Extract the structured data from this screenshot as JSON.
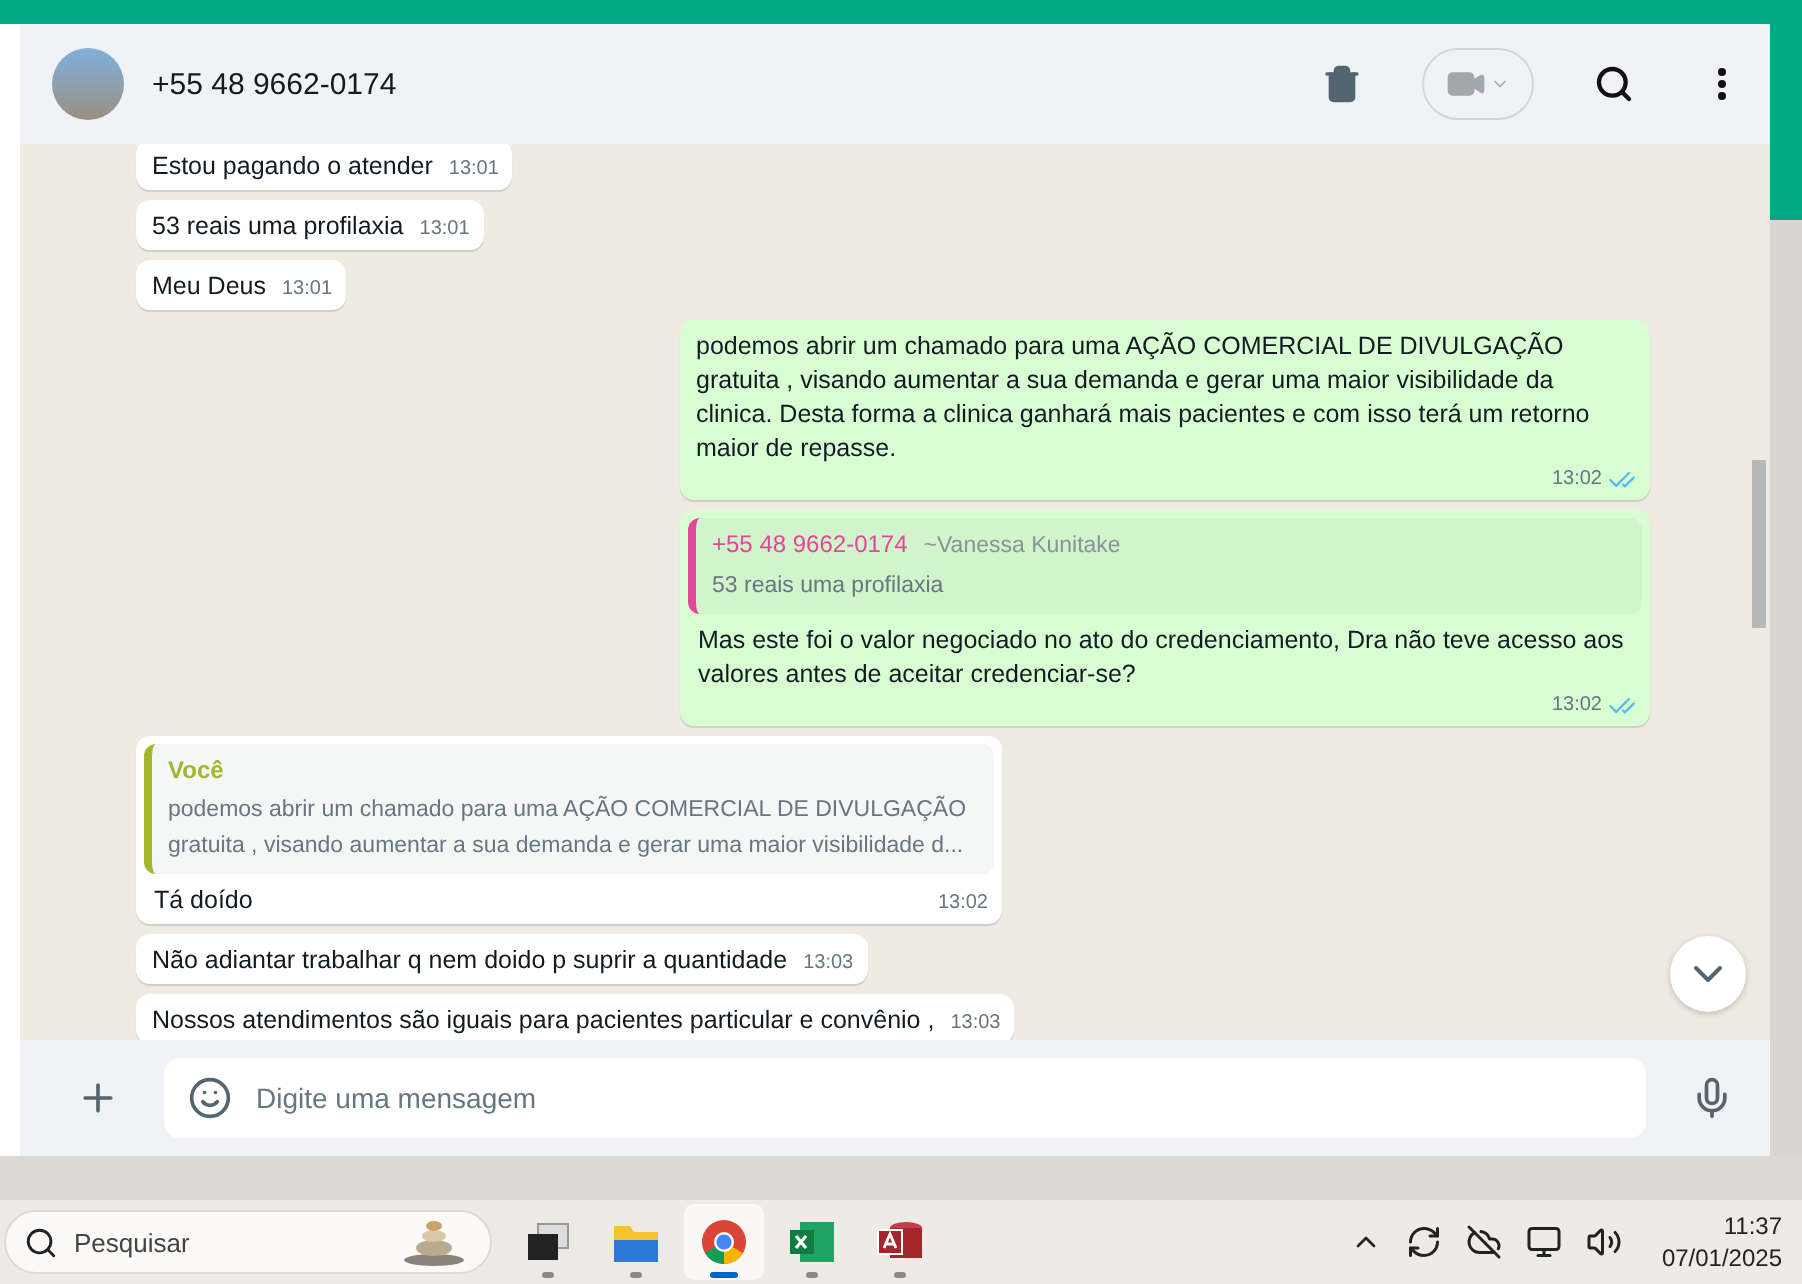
{
  "chat_header": {
    "contact": "+55 48 9662-0174"
  },
  "messages": [
    {
      "kind": "in",
      "text": "Estou pagando o atender",
      "time": "13:01"
    },
    {
      "kind": "in",
      "text": "53 reais uma profilaxia",
      "time": "13:01"
    },
    {
      "kind": "in",
      "text": "Meu Deus",
      "time": "13:01"
    },
    {
      "kind": "out",
      "text": "podemos abrir um chamado para uma AÇÃO COMERCIAL DE DIVULGAÇÃO gratuita , visando aumentar a sua demanda e gerar uma maior visibilidade da clinica. Desta forma a clinica ganhará mais pacientes e com isso terá um retorno maior de repasse.",
      "time": "13:02",
      "read": true
    },
    {
      "kind": "out",
      "quote": {
        "author": "+55 48 9662-0174",
        "author_note": "~Vanessa Kunitake",
        "text": "53 reais uma profilaxia",
        "color": "#e0489a"
      },
      "text": "Mas este foi o valor negociado no ato do credenciamento, Dra não teve acesso aos valores antes de aceitar credenciar-se?",
      "time": "13:02",
      "read": true
    },
    {
      "kind": "in",
      "quote": {
        "author": "Você",
        "text": "podemos abrir um chamado para uma AÇÃO COMERCIAL DE DIVULGAÇÃO gratuita , visando aumentar a sua demanda e gerar uma maior visibilidade d...",
        "color": "#a5b52c"
      },
      "text": "Tá doído",
      "time": "13:02"
    },
    {
      "kind": "in",
      "text": "Não adiantar trabalhar q nem doido p suprir a quantidade",
      "time": "13:03"
    },
    {
      "kind": "in",
      "text": "Nossos atendimentos são iguais para pacientes particular e convênio ,",
      "time": "13:03"
    }
  ],
  "composer": {
    "placeholder": "Digite uma mensagem"
  },
  "taskbar": {
    "search_placeholder": "Pesquisar",
    "apps": [
      {
        "kind": "taskview",
        "selected": false
      },
      {
        "kind": "files",
        "selected": false
      },
      {
        "kind": "browser",
        "selected": true
      },
      {
        "kind": "sheet",
        "selected": false
      },
      {
        "kind": "database",
        "selected": false
      }
    ],
    "time": "11:37",
    "date": "07/01/2025"
  }
}
